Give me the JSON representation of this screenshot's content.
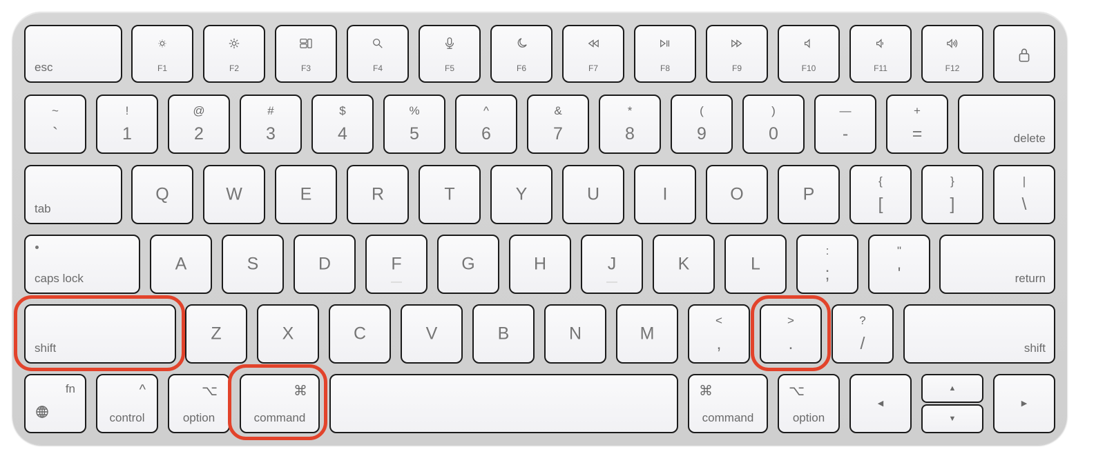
{
  "highlight_color": "#e2432b",
  "highlighted_keys": [
    "left-shift",
    "left-command",
    "period"
  ],
  "rows": [
    [
      {
        "id": "esc",
        "label": "esc"
      },
      {
        "id": "f1",
        "label": "F1",
        "icon": "brightness-down-icon"
      },
      {
        "id": "f2",
        "label": "F2",
        "icon": "brightness-up-icon"
      },
      {
        "id": "f3",
        "label": "F3",
        "icon": "mission-control-icon"
      },
      {
        "id": "f4",
        "label": "F4",
        "icon": "search-icon"
      },
      {
        "id": "f5",
        "label": "F5",
        "icon": "microphone-icon"
      },
      {
        "id": "f6",
        "label": "F6",
        "icon": "moon-icon"
      },
      {
        "id": "f7",
        "label": "F7",
        "icon": "rewind-icon"
      },
      {
        "id": "f8",
        "label": "F8",
        "icon": "play-pause-icon"
      },
      {
        "id": "f9",
        "label": "F9",
        "icon": "fast-forward-icon"
      },
      {
        "id": "f10",
        "label": "F10",
        "icon": "mute-icon"
      },
      {
        "id": "f11",
        "label": "F11",
        "icon": "volume-down-icon"
      },
      {
        "id": "f12",
        "label": "F12",
        "icon": "volume-up-icon"
      },
      {
        "id": "lock",
        "icon": "lock-icon"
      }
    ],
    [
      {
        "id": "backtick",
        "top": "~",
        "bottom": "`"
      },
      {
        "id": "1",
        "top": "!",
        "bottom": "1"
      },
      {
        "id": "2",
        "top": "@",
        "bottom": "2"
      },
      {
        "id": "3",
        "top": "#",
        "bottom": "3"
      },
      {
        "id": "4",
        "top": "$",
        "bottom": "4"
      },
      {
        "id": "5",
        "top": "%",
        "bottom": "5"
      },
      {
        "id": "6",
        "top": "^",
        "bottom": "6"
      },
      {
        "id": "7",
        "top": "&",
        "bottom": "7"
      },
      {
        "id": "8",
        "top": "*",
        "bottom": "8"
      },
      {
        "id": "9",
        "top": "(",
        "bottom": "9"
      },
      {
        "id": "0",
        "top": ")",
        "bottom": "0"
      },
      {
        "id": "minus",
        "top": "—",
        "bottom": "-"
      },
      {
        "id": "equals",
        "top": "+",
        "bottom": "="
      },
      {
        "id": "delete",
        "label": "delete"
      }
    ],
    [
      {
        "id": "tab",
        "label": "tab"
      },
      {
        "id": "q",
        "letter": "Q"
      },
      {
        "id": "w",
        "letter": "W"
      },
      {
        "id": "e",
        "letter": "E"
      },
      {
        "id": "r",
        "letter": "R"
      },
      {
        "id": "t",
        "letter": "T"
      },
      {
        "id": "y",
        "letter": "Y"
      },
      {
        "id": "u",
        "letter": "U"
      },
      {
        "id": "i",
        "letter": "I"
      },
      {
        "id": "o",
        "letter": "O"
      },
      {
        "id": "p",
        "letter": "P"
      },
      {
        "id": "lbracket",
        "top": "{",
        "bottom": "["
      },
      {
        "id": "rbracket",
        "top": "}",
        "bottom": "]"
      },
      {
        "id": "backslash",
        "top": "|",
        "bottom": "\\"
      }
    ],
    [
      {
        "id": "caps-lock",
        "label": "caps lock"
      },
      {
        "id": "a",
        "letter": "A"
      },
      {
        "id": "s",
        "letter": "S"
      },
      {
        "id": "d",
        "letter": "D"
      },
      {
        "id": "f",
        "letter": "F"
      },
      {
        "id": "g",
        "letter": "G"
      },
      {
        "id": "h",
        "letter": "H"
      },
      {
        "id": "j",
        "letter": "J"
      },
      {
        "id": "k",
        "letter": "K"
      },
      {
        "id": "l",
        "letter": "L"
      },
      {
        "id": "semicolon",
        "top": ":",
        "bottom": ";"
      },
      {
        "id": "quote",
        "top": "\"",
        "bottom": "'"
      },
      {
        "id": "return",
        "label": "return"
      }
    ],
    [
      {
        "id": "left-shift",
        "label": "shift"
      },
      {
        "id": "z",
        "letter": "Z"
      },
      {
        "id": "x",
        "letter": "X"
      },
      {
        "id": "c",
        "letter": "C"
      },
      {
        "id": "v",
        "letter": "V"
      },
      {
        "id": "b",
        "letter": "B"
      },
      {
        "id": "n",
        "letter": "N"
      },
      {
        "id": "m",
        "letter": "M"
      },
      {
        "id": "comma",
        "top": "<",
        "bottom": ","
      },
      {
        "id": "period",
        "top": ">",
        "bottom": "."
      },
      {
        "id": "slash",
        "top": "?",
        "bottom": "/"
      },
      {
        "id": "right-shift",
        "label": "shift"
      }
    ],
    [
      {
        "id": "fn",
        "label": "fn",
        "icon": "globe-icon"
      },
      {
        "id": "control",
        "label": "control",
        "symbol": "^"
      },
      {
        "id": "left-option",
        "label": "option",
        "symbol": "⌥"
      },
      {
        "id": "left-command",
        "label": "command",
        "symbol": "⌘"
      },
      {
        "id": "space"
      },
      {
        "id": "right-command",
        "label": "command",
        "symbol": "⌘"
      },
      {
        "id": "right-option",
        "label": "option",
        "symbol": "⌥"
      },
      {
        "id": "arrow-left",
        "arrow": "◀"
      },
      {
        "id": "arrow-up",
        "arrow": "▲"
      },
      {
        "id": "arrow-down",
        "arrow": "▼"
      },
      {
        "id": "arrow-right",
        "arrow": "▶"
      }
    ]
  ]
}
